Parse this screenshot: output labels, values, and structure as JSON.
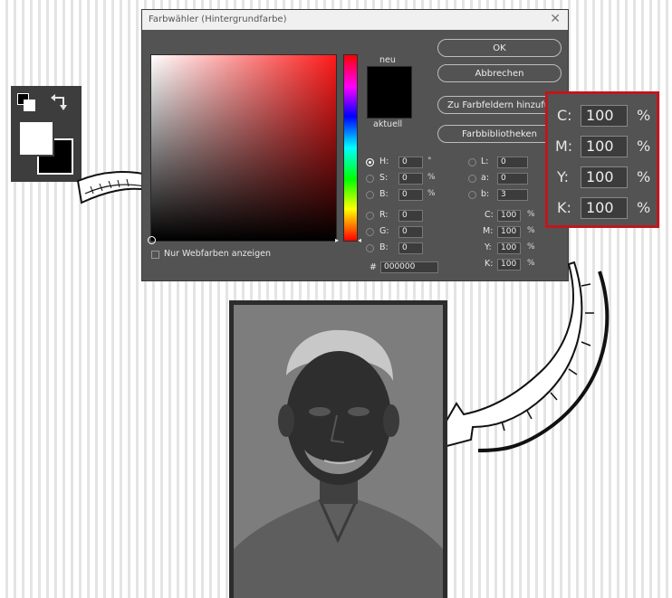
{
  "dialog": {
    "title": "Farbwähler (Hintergrundfarbe)",
    "close": "✕",
    "ok": "OK",
    "cancel": "Abbrechen",
    "add_swatches": "Zu Farbfeldern hinzufügen",
    "libraries": "Farbbibliotheken",
    "new_label": "neu",
    "current_label": "aktuell",
    "web_only": "Nur Webfarben anzeigen",
    "hex_label": "#",
    "hex_value": "000000",
    "selected_color": "#000000",
    "hsb": [
      {
        "label": "H:",
        "value": "0",
        "unit": "°",
        "selected": true
      },
      {
        "label": "S:",
        "value": "0",
        "unit": "%",
        "selected": false
      },
      {
        "label": "B:",
        "value": "0",
        "unit": "%",
        "selected": false
      }
    ],
    "rgb": [
      {
        "label": "R:",
        "value": "0"
      },
      {
        "label": "G:",
        "value": "0"
      },
      {
        "label": "B:",
        "value": "0"
      }
    ],
    "lab": [
      {
        "label": "L:",
        "value": "0"
      },
      {
        "label": "a:",
        "value": "0"
      },
      {
        "label": "b:",
        "value": "3"
      }
    ],
    "cmyk": [
      {
        "label": "C:",
        "value": "100",
        "unit": "%"
      },
      {
        "label": "M:",
        "value": "100",
        "unit": "%"
      },
      {
        "label": "Y:",
        "value": "100",
        "unit": "%"
      },
      {
        "label": "K:",
        "value": "100",
        "unit": "%"
      }
    ]
  },
  "zoom_cmyk": [
    {
      "label": "C:",
      "value": "100",
      "unit": "%"
    },
    {
      "label": "M:",
      "value": "100",
      "unit": "%"
    },
    {
      "label": "Y:",
      "value": "100",
      "unit": "%"
    },
    {
      "label": "K:",
      "value": "100",
      "unit": "%"
    }
  ],
  "colors": {
    "highlight_border": "#c1161d",
    "dialog_bg": "#535353",
    "foreground": "#ffffff",
    "background": "#000000"
  },
  "icons": [
    "default-colors-icon",
    "swap-colors-icon",
    "arrow-icon"
  ]
}
